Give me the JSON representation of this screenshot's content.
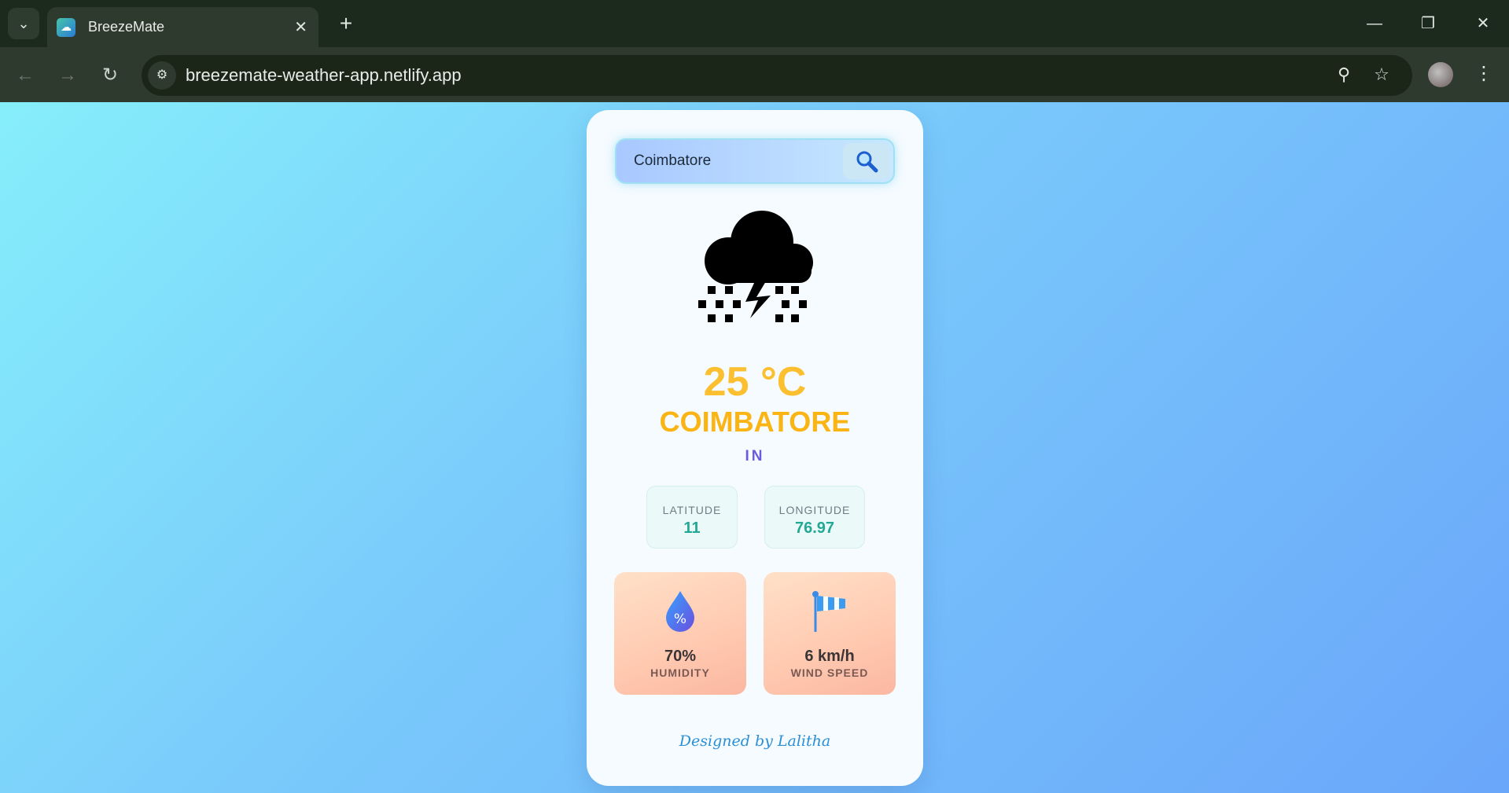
{
  "browser": {
    "tab_title": "BreezeMate",
    "url": "breezemate-weather-app.netlify.app"
  },
  "search": {
    "value": "Coimbatore",
    "placeholder": ""
  },
  "weather": {
    "condition_icon": "thunder-snow-cloud-icon",
    "temperature": "25 °C",
    "city": "COIMBATORE",
    "country": "IN"
  },
  "coordinates": {
    "latitude_label": "LATITUDE",
    "latitude_value": "11",
    "longitude_label": "LONGITUDE",
    "longitude_value": "76.97"
  },
  "stats": {
    "humidity_value": "70%",
    "humidity_label": "HUMIDITY",
    "wind_value": "6 km/h",
    "wind_label": "WIND SPEED"
  },
  "footer": {
    "credit": "Designed by Lalitha"
  },
  "colors": {
    "temperature": "#fbbf30",
    "city": "#fab414",
    "country": "#6a5ae0",
    "coord_value": "#22a895",
    "footer": "#2b8fd6"
  }
}
